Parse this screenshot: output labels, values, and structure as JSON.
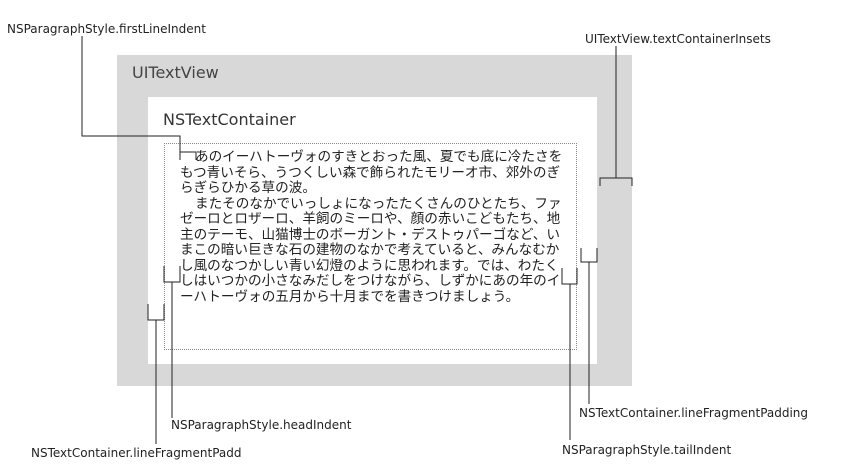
{
  "labels": {
    "first_line_indent": "NSParagraphStyle.firstLineIndent",
    "text_container_insets": "UITextView.textContainerInsets",
    "head_indent": "NSParagraphStyle.headIndent",
    "line_fragment_padding_right": "NSTextContainer.lineFragmentPadding",
    "line_fragment_padding_left": "NSTextContainer.lineFragmentPadd",
    "tail_indent": "NSParagraphStyle.tailIndent"
  },
  "boxes": {
    "text_view_title": "UITextView",
    "text_container_title": "NSTextContainer"
  },
  "body_text": {
    "paragraph_1": "あのイーハトーヴォのすきとおった風、夏でも底に冷たさをもつ青いそら、うつくしい森で飾られたモリーオ市、郊外のぎらぎらひかる草の波。",
    "paragraph_2": "またそのなかでいっしょになったたくさんのひとたち、ファゼーロとロザーロ、羊飼のミーロや、顔の赤いこどもたち、地主のテーモ、山猫博士のボーガント・デストゥパーゴなど、いまこの暗い巨きな石の建物のなかで考えていると、みんなむかし風のなつかしい青い幻燈のように思われます。では、わたくしはいつかの小さなみだしをつけながら、しずかにあの年のイーハトーヴォの五月から十月までを書きつけましょう。"
  }
}
